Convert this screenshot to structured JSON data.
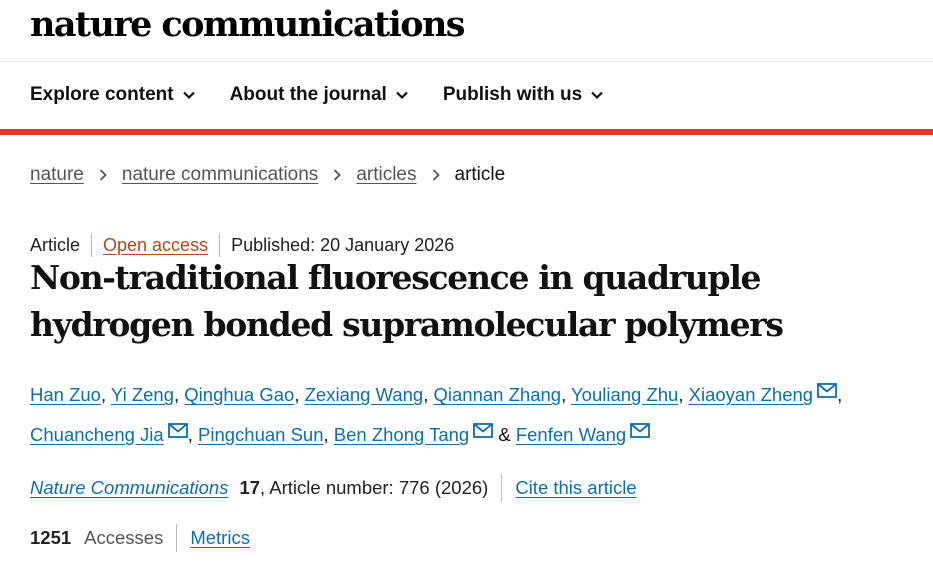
{
  "site": {
    "logo": "nature communications"
  },
  "nav": {
    "explore": "Explore content",
    "about": "About the journal",
    "publish": "Publish with us"
  },
  "breadcrumb": {
    "items": [
      "nature",
      "nature communications",
      "articles"
    ],
    "current": "article"
  },
  "article": {
    "type": "Article",
    "access": "Open access",
    "published": "Published: 20 January 2026",
    "title": "Non-traditional fluorescence in quadruple hydrogen bonded supramolecular polymers",
    "authors": [
      "Han Zuo",
      "Yi Zeng",
      "Qinghua Gao",
      "Zexiang Wang",
      "Qiannan Zhang",
      "Youliang Zhu",
      "Xiaoyan Zheng",
      "Chuancheng Jia",
      "Pingchuan Sun",
      "Ben Zhong Tang",
      "Fenfen Wang"
    ],
    "author_separator": ",",
    "author_conjunction": "&",
    "journal": "Nature Communications",
    "volume": "17",
    "article_number": ", Article number: 776 (2026)",
    "cite": "Cite this article"
  },
  "metrics": {
    "count": "1251",
    "accesses_label": "Accesses",
    "metrics_link": "Metrics"
  },
  "colors": {
    "accent_red": "#e0362b",
    "link_blue": "#0f6ea8",
    "open_access": "#b5471b"
  },
  "icons": {
    "nav_dropdown": "chevron-down-icon",
    "breadcrumb_separator": "chevron-right-icon",
    "corresponding_author": "mail-icon"
  }
}
